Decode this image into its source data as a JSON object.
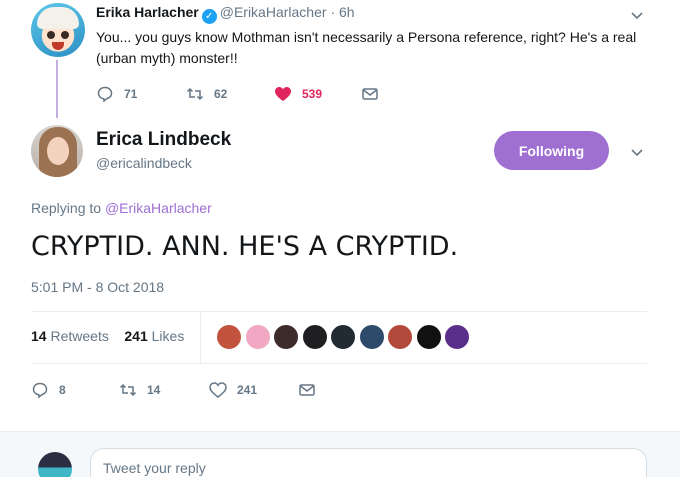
{
  "parent_tweet": {
    "name": "Erika Harlacher",
    "handle": "@ErikaHarlacher",
    "dot": "·",
    "time": "6h",
    "text": "You... you guys know Mothman isn't necessarily a Persona reference, right? He's a real (urban myth) monster!!",
    "replies": "71",
    "retweets": "62",
    "likes": "539",
    "liked_color": "#e0245e"
  },
  "main_tweet": {
    "name": "Erica Lindbeck",
    "handle": "@ericalindbeck",
    "follow_label": "Following",
    "replying_prefix": "Replying to",
    "replying_to": "@ErikaHarlacher",
    "text": "CRYPTID. ANN. HE'S A CRYPTID.",
    "timestamp": "5:01 PM - 8 Oct 2018",
    "retweet_count": "14",
    "retweet_label": "Retweets",
    "like_count": "241",
    "like_label": "Likes",
    "likers": [
      {
        "color": "#c2543f"
      },
      {
        "color": "#f2a7c3"
      },
      {
        "color": "#3d2a2a"
      },
      {
        "color": "#1f1f22"
      },
      {
        "color": "#222a34"
      },
      {
        "color": "#2e4a6b"
      },
      {
        "color": "#b24a3b"
      },
      {
        "color": "#111111"
      },
      {
        "color": "#5a2f8a"
      }
    ],
    "action_replies": "8",
    "action_retweets": "14",
    "action_likes": "241"
  },
  "reply_box": {
    "placeholder": "Tweet your reply"
  },
  "colors": {
    "accent": "#9f6fd2",
    "muted": "#657786",
    "text": "#14171a",
    "like": "#e0245e"
  }
}
